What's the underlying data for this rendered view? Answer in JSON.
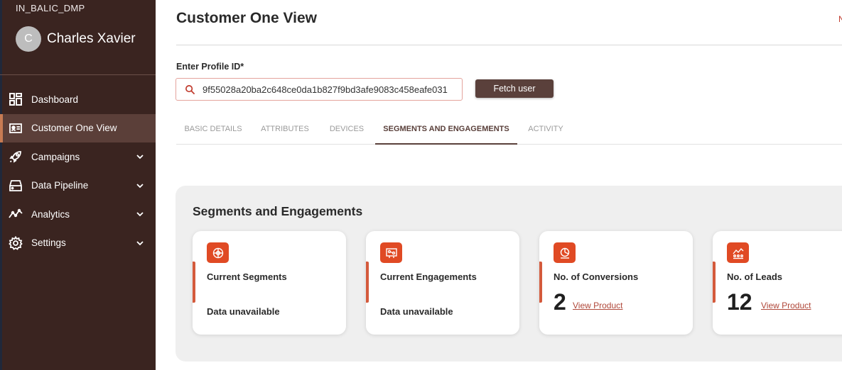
{
  "sidebar": {
    "org": "IN_BALIC_DMP",
    "avatar_initial": "C",
    "user_name": "Charles Xavier",
    "items": [
      {
        "label": "Dashboard",
        "icon": "dashboard-icon"
      },
      {
        "label": "Customer One View",
        "icon": "id-card-icon"
      },
      {
        "label": "Campaigns",
        "icon": "rocket-icon"
      },
      {
        "label": "Data Pipeline",
        "icon": "server-icon"
      },
      {
        "label": "Analytics",
        "icon": "analytics-icon"
      },
      {
        "label": "Settings",
        "icon": "gear-icon"
      }
    ]
  },
  "header": {
    "title": "Customer One View",
    "corner_text": "N"
  },
  "profile": {
    "label": "Enter Profile ID*",
    "value": "9f55028a20ba2c648ce0da1b827f9bd3afe9083c458eafe031",
    "button": "Fetch user"
  },
  "tabs": [
    "BASIC DETAILS",
    "ATTRIBUTES",
    "DEVICES",
    "SEGMENTS AND ENGAGEMENTS",
    "ACTIVITY"
  ],
  "active_tab": "SEGMENTS AND ENGAGEMENTS",
  "panel": {
    "title": "Segments and Engagements",
    "cards": [
      {
        "title": "Current Segments",
        "value": "Data unavailable",
        "icon": "segments-icon"
      },
      {
        "title": "Current Engagements",
        "value": "Data unavailable",
        "icon": "engagements-icon"
      },
      {
        "title": "No. of Conversions",
        "count": "2",
        "link": "View Product",
        "icon": "conversions-icon"
      },
      {
        "title": "No. of Leads",
        "count": "12",
        "link": "View Product",
        "icon": "leads-icon"
      }
    ]
  },
  "colors": {
    "sidebar_bg": "#3a2420",
    "accent": "#5a403b",
    "icon_bg": "#e04a24",
    "link": "#b0483a"
  }
}
